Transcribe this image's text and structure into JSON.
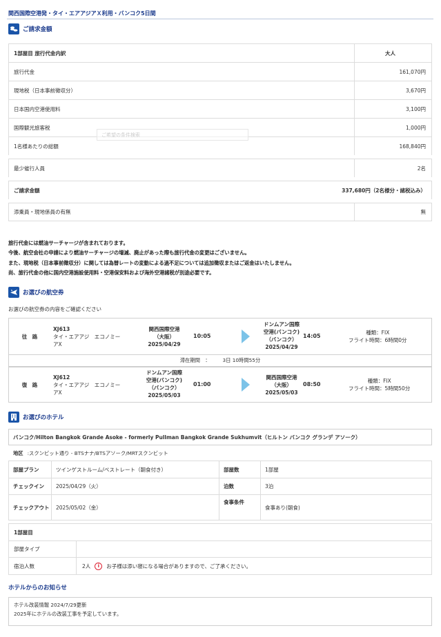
{
  "page": {
    "title": "関西国際空港発・タイ・エアアジアＸ利用・バンコク5日間"
  },
  "billing": {
    "heading": "ご請求金額",
    "header_label": "1部屋目 旅行代金内訳",
    "header_col": "大人",
    "rows": [
      {
        "label": "旅行代金",
        "value": "161,070円"
      },
      {
        "label": "現地税（日本事前徴収分）",
        "value": "3,670円"
      },
      {
        "label": "日本国内空港使用料",
        "value": "3,100円"
      },
      {
        "label": "国際観光旅客税",
        "value": "1,000円"
      }
    ],
    "per_person_label": "1名様あたりの総額",
    "per_person_value": "168,840円",
    "min_people_label": "最少催行人員",
    "min_people_value": "2名",
    "total_label": "ご請求金額",
    "total_value": "337,680円（2名様分・諸税込み）",
    "escort_label": "添乗員・現地係員の有無",
    "escort_value": "無",
    "overlay_text": "ご希望の条件検索"
  },
  "notes": [
    "旅行代金には燃油サーチャージが含まれております。",
    "今後、航空会社の申請により燃油サーチャージの増減、廃止があった際も旅行代金の変更はございません。",
    "また、現地税（日本事前徴収分）に関しては為替レートの変動による過不足については追加徴収またはご返金はいたしません。",
    "尚、旅行代金の他に国内空港施設使用料・空港保安料および海外空港諸税が別途必要です。"
  ],
  "flights": {
    "heading": "お選びの航空券",
    "subtext": "お選びの航空券の内容をご確認ください",
    "outbound": {
      "direction": "往　路",
      "code": "XJ613",
      "airline": "タイ・エアアジ　エコノミー",
      "airline2": "アX",
      "dep_place": [
        "関西国際空港",
        "（大阪）"
      ],
      "dep_date": "2025/04/29",
      "dep_time": "10:05",
      "arr_place": [
        "ドンムアン国際",
        "空港(バンコク)",
        "（バンコク）"
      ],
      "arr_date": "2025/04/29",
      "arr_time": "14:05",
      "type": "種類：FIX",
      "duration": "フライト時間：6時間0分"
    },
    "stay_label": "滞在期間　：",
    "stay_value": "3日 10時間55分",
    "inbound": {
      "direction": "復　路",
      "code": "XJ612",
      "airline": "タイ・エアアジ　エコノミー",
      "airline2": "アX",
      "dep_place": [
        "ドンムアン国際",
        "空港(バンコク)",
        "（バンコク）"
      ],
      "dep_date": "2025/05/03",
      "dep_time": "01:00",
      "arr_place": [
        "関西国際空港",
        "（大阪）"
      ],
      "arr_date": "2025/05/03",
      "arr_time": "08:50",
      "type": "種類：FIX",
      "duration": "フライト時間：5時間50分"
    }
  },
  "hotel": {
    "heading": "お選びのホテル",
    "name": "バンコク/Hilton Bangkok Grande Asoke - formerly Pullman Bangkok Grande Sukhumvit（ヒルトン バンコク グランデ アソーク）",
    "area_label": "地区",
    "area_value": ":スクンビット通り - BTSナナ/BTSアソーク/MRTスクンビット",
    "plan_label": "部屋プラン",
    "plan_value": "ツインゲストルーム/ベストレート（朝食付き）",
    "rooms_label": "部屋数",
    "rooms_value": "1部屋",
    "checkin_label": "チェックイン",
    "checkin_value": "2025/04/29（火）",
    "nights_label": "泊数",
    "nights_value": "3泊",
    "checkout_label": "チェックアウト",
    "checkout_value": "2025/05/02（金）",
    "meal_label": "食事条件",
    "meal_value": "食事あり(朝食)",
    "room1_title": "1部屋目",
    "roomtype_label": "部屋タイプ",
    "roomtype_value": "",
    "guests_label": "宿泊人数",
    "guests_value": "2人",
    "guests_note": "お子様は添い寝になる場合がありますので、ご了承ください。"
  },
  "notice": {
    "heading": "ホテルからのお知らせ",
    "line1": "ホテル改装情報 2024/7/29更新",
    "line2": "2025年にホテルの改装工事を予定しています。"
  }
}
